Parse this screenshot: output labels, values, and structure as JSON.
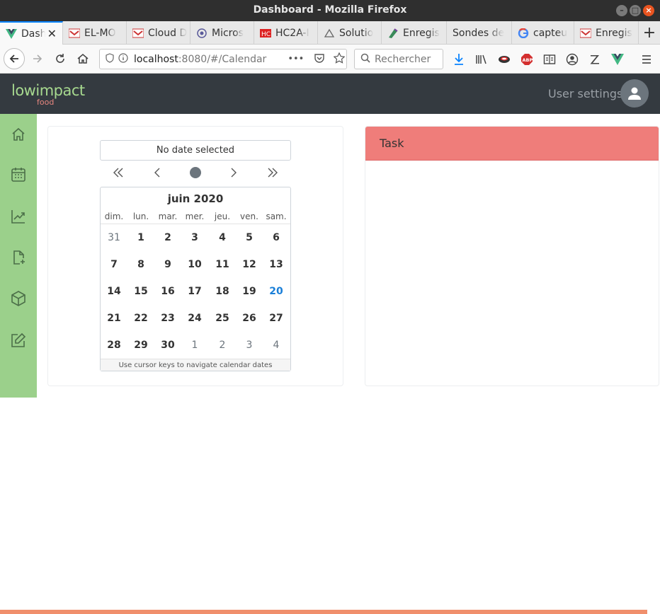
{
  "window": {
    "title": "Dashboard - Mozilla Firefox",
    "controls": {
      "minimize": "–",
      "maximize": "□",
      "close": "×"
    }
  },
  "tabs": [
    {
      "label": "Dashboard",
      "icon": "vue-icon",
      "active": true
    },
    {
      "label": "EL-MO",
      "icon": "site-icon"
    },
    {
      "label": "Cloud D",
      "icon": "site-icon"
    },
    {
      "label": "Micros",
      "icon": "site-icon"
    },
    {
      "label": "HC2A-I",
      "icon": "site-icon"
    },
    {
      "label": "Solutio",
      "icon": "site-icon"
    },
    {
      "label": "Enregis",
      "icon": "site-icon"
    },
    {
      "label": "Sondes de",
      "icon": ""
    },
    {
      "label": "capteu",
      "icon": "google-icon"
    },
    {
      "label": "Enregis",
      "icon": "site-icon"
    }
  ],
  "new_tab": "+",
  "navbar": {
    "url_host": "localhost",
    "url_path": ":8080/#/Calendar",
    "url_more": "•••",
    "search_placeholder": "Rechercher"
  },
  "app": {
    "logo_main": "lowimpact",
    "logo_sub": "food",
    "user_settings": "User settings"
  },
  "sidebar": {
    "items": [
      "home-icon",
      "calendar-icon",
      "chart-icon",
      "file-add-icon",
      "box-icon",
      "edit-icon"
    ]
  },
  "calendar": {
    "selected_text": "No date selected",
    "month_label": "juin 2020",
    "weekdays": [
      "dim.",
      "lun.",
      "mar.",
      "mer.",
      "jeu.",
      "ven.",
      "sam."
    ],
    "weeks": [
      [
        "31",
        "1",
        "2",
        "3",
        "4",
        "5",
        "6"
      ],
      [
        "7",
        "8",
        "9",
        "10",
        "11",
        "12",
        "13"
      ],
      [
        "14",
        "15",
        "16",
        "17",
        "18",
        "19",
        "20"
      ],
      [
        "21",
        "22",
        "23",
        "24",
        "25",
        "26",
        "27"
      ],
      [
        "28",
        "29",
        "30",
        "1",
        "2",
        "3",
        "4"
      ]
    ],
    "today": "20",
    "footer": "Use cursor keys to navigate calendar dates"
  },
  "task": {
    "header": "Task"
  },
  "colors": {
    "sidebar": "#9bd08b",
    "app_header": "#343a40",
    "task_header": "#ef7d7a",
    "today": "#1a7fd8",
    "logo_main": "#a7d98f",
    "logo_sub": "#e8877f"
  }
}
